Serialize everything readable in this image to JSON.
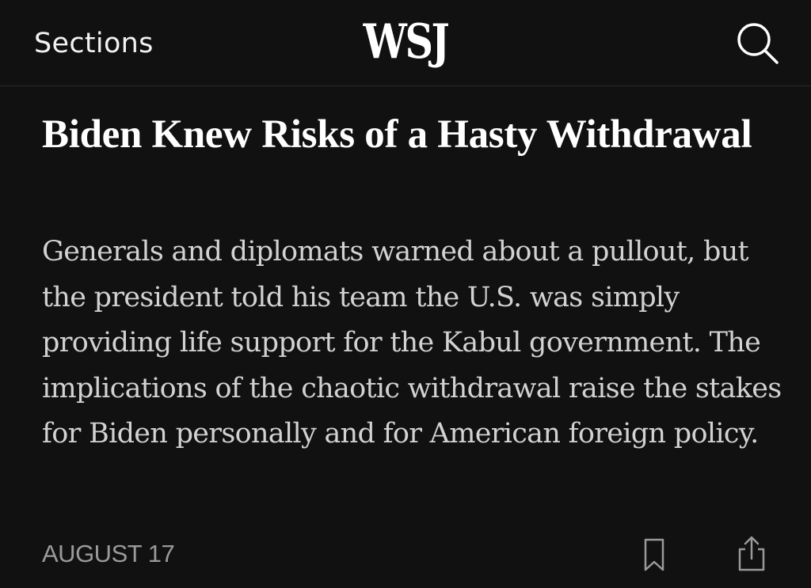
{
  "header": {
    "sections_label": "Sections",
    "logo_text": "WSJ",
    "search_icon": "search-icon"
  },
  "article": {
    "headline": "Biden Knew Risks of a Hasty Withdrawal",
    "summary": "Generals and diplomats warned about a pullout, but the president told his team the U.S. was simply providing life support for the Kabul government. The implications of the chaotic withdrawal raise the stakes for Biden personally and for American foreign policy.",
    "date": "AUGUST 17",
    "bookmark_icon": "bookmark-icon",
    "share_icon": "share-icon"
  },
  "colors": {
    "background": "#111111",
    "headline": "#ffffff",
    "summary": "#d2d2d2",
    "date": "#9a9a9a",
    "divider": "#2a2a2a"
  }
}
